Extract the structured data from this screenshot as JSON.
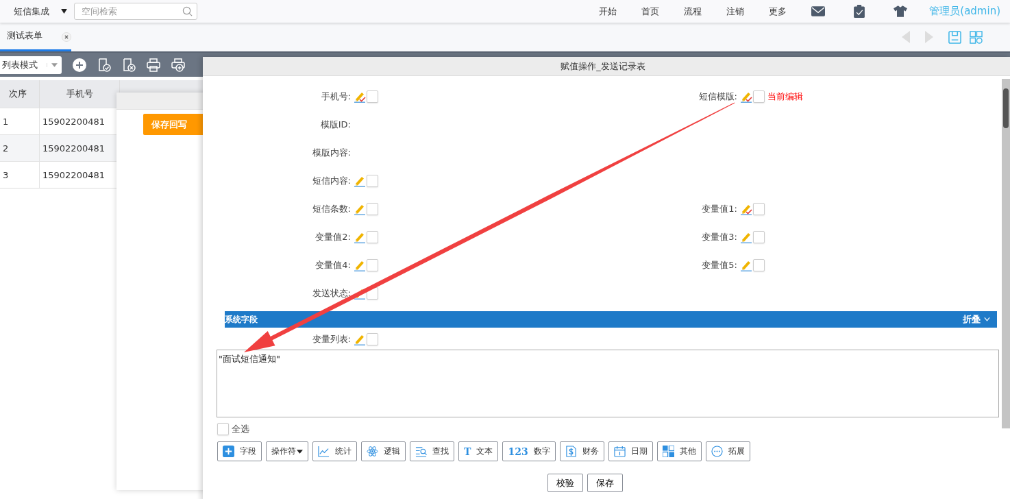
{
  "top_bar": {
    "space": "短信集成",
    "search": {
      "placeholder": "空间检索"
    },
    "nav": [
      "开始",
      "首页",
      "流程",
      "注销",
      "更多"
    ],
    "user": "管理员(admin)"
  },
  "tabs": [
    {
      "label": "测试表单",
      "selected": true
    }
  ],
  "list_toolbar": {
    "mode": "列表模式"
  },
  "table": {
    "columns": [
      "次序",
      "手机号"
    ],
    "rows": [
      [
        "1",
        "15902200481"
      ],
      [
        "2",
        "15902200481"
      ],
      [
        "3",
        "15902200481"
      ]
    ]
  },
  "side_dialog": {
    "button": "保存回写"
  },
  "dialog": {
    "title": "赋值操作_发送记录表",
    "rows": [
      {
        "left": {
          "label": "手机号:",
          "editable": true,
          "marked": true,
          "checked": false
        },
        "right": {
          "label": "短信模版:",
          "editable": true,
          "marked": true,
          "checked": false,
          "note": "当前编辑"
        }
      },
      {
        "left": {
          "label": "模版ID:",
          "editable": false
        }
      },
      {
        "left": {
          "label": "模版内容:",
          "editable": false
        }
      },
      {
        "left": {
          "label": "短信内容:",
          "editable": true,
          "marked": false,
          "checked": false
        }
      },
      {
        "left": {
          "label": "短信条数:",
          "editable": true,
          "marked": false,
          "checked": false
        },
        "right": {
          "label": "变量值1:",
          "editable": true,
          "marked": true,
          "checked": false
        }
      },
      {
        "left": {
          "label": "变量值2:",
          "editable": true,
          "marked": false,
          "checked": false
        },
        "right": {
          "label": "变量值3:",
          "editable": true,
          "marked": false,
          "checked": false
        }
      },
      {
        "left": {
          "label": "变量值4:",
          "editable": true,
          "marked": false,
          "checked": false
        },
        "right": {
          "label": "变量值5:",
          "editable": true,
          "marked": false,
          "checked": false
        }
      },
      {
        "left": {
          "label": "发送状态:",
          "editable": true,
          "marked": false,
          "checked": false
        }
      }
    ],
    "section": {
      "title": "系统字段",
      "toggle": "折叠"
    },
    "extra_row": {
      "label": "变量列表:",
      "editable": true,
      "marked": false,
      "checked": false
    },
    "expression": "\"面试短信通知\"",
    "select_all": {
      "label": "全选",
      "checked": false
    },
    "tools": [
      {
        "label": "字段",
        "kind": "plus"
      },
      {
        "label": "操作符",
        "kind": "dropdown"
      },
      {
        "label": "统计",
        "kind": "chart"
      },
      {
        "label": "逻辑",
        "kind": "atom"
      },
      {
        "label": "查找",
        "kind": "find"
      },
      {
        "label": "文本",
        "kind": "glyph",
        "glyph": "T"
      },
      {
        "label": "数字",
        "kind": "glyph",
        "glyph": "123"
      },
      {
        "label": "财务",
        "kind": "money"
      },
      {
        "label": "日期",
        "kind": "calendar"
      },
      {
        "label": "其他",
        "kind": "grid"
      },
      {
        "label": "拓展",
        "kind": "more"
      }
    ],
    "buttons": [
      "校验",
      "保存"
    ]
  }
}
